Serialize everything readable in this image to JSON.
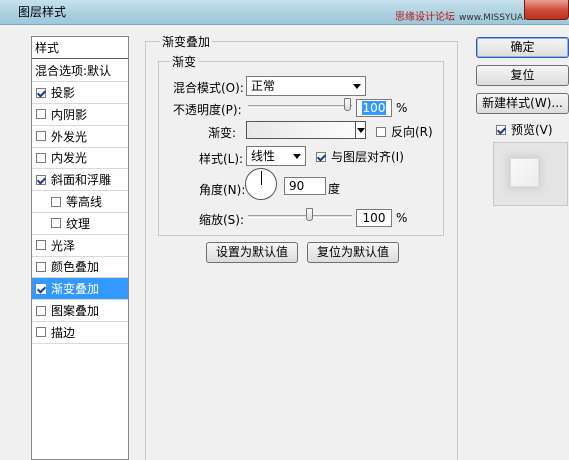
{
  "window": {
    "title": "图层样式",
    "watermark": "思缘设计论坛",
    "watermark_domain": "www.MISSYUAN.COM",
    "accent_color": "#3399ff",
    "close_color": "#cf4a32"
  },
  "left_panel": {
    "header": "样式",
    "blend_options": "混合选项:默认",
    "items": [
      {
        "label": "投影",
        "checked": true,
        "selected": false,
        "sub": false
      },
      {
        "label": "内阴影",
        "checked": false,
        "selected": false,
        "sub": false
      },
      {
        "label": "外发光",
        "checked": false,
        "selected": false,
        "sub": false
      },
      {
        "label": "内发光",
        "checked": false,
        "selected": false,
        "sub": false
      },
      {
        "label": "斜面和浮雕",
        "checked": true,
        "selected": false,
        "sub": false
      },
      {
        "label": "等高线",
        "checked": false,
        "selected": false,
        "sub": true
      },
      {
        "label": "纹理",
        "checked": false,
        "selected": false,
        "sub": true
      },
      {
        "label": "光泽",
        "checked": false,
        "selected": false,
        "sub": false
      },
      {
        "label": "颜色叠加",
        "checked": false,
        "selected": false,
        "sub": false
      },
      {
        "label": "渐变叠加",
        "checked": true,
        "selected": true,
        "sub": false
      },
      {
        "label": "图案叠加",
        "checked": false,
        "selected": false,
        "sub": false
      },
      {
        "label": "描边",
        "checked": false,
        "selected": false,
        "sub": false
      }
    ]
  },
  "gradient_overlay": {
    "group_title": "渐变叠加",
    "inner_title": "渐变",
    "blend_mode_label": "混合模式(O):",
    "blend_mode_value": "正常",
    "opacity_label": "不透明度(P):",
    "opacity_value": "100",
    "opacity_unit": "%",
    "opacity_percent": 100,
    "gradient_label": "渐变:",
    "reverse_label": "反向(R)",
    "reverse_checked": false,
    "style_label": "样式(L):",
    "style_value": "线性",
    "align_label": "与图层对齐(I)",
    "align_checked": true,
    "angle_label": "角度(N):",
    "angle_value": "90",
    "angle_unit": "度",
    "scale_label": "缩放(S):",
    "scale_value": "100",
    "scale_unit": "%",
    "scale_percent": 100,
    "make_default_button": "设置为默认值",
    "reset_default_button": "复位为默认值"
  },
  "right_panel": {
    "ok_button": "确定",
    "reset_button": "复位",
    "new_style_button": "新建样式(W)...",
    "preview_label": "预览(V)",
    "preview_checked": true
  }
}
